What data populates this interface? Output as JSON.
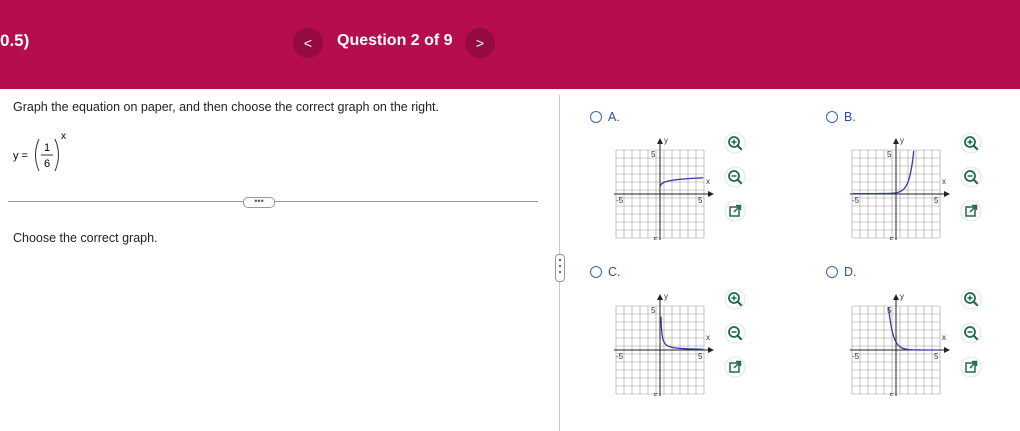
{
  "header": {
    "left_text": "0.5)",
    "question_label": "Question 2 of 9",
    "prev_glyph": "<",
    "next_glyph": ">"
  },
  "prompt": "Graph the equation on paper, and then choose the correct graph on the right.",
  "equation": {
    "lhs": "y =",
    "numerator": "1",
    "denominator": "6",
    "exponent": "x"
  },
  "more_button": "•••",
  "choose_text": "Choose the correct graph.",
  "options": [
    {
      "letter": "A.",
      "curve": "log-up-from-asymptote"
    },
    {
      "letter": "B.",
      "curve": "exp-growth"
    },
    {
      "letter": "C.",
      "curve": "recip-decay"
    },
    {
      "letter": "D.",
      "curve": "steep-decay"
    }
  ],
  "axis": {
    "x_label": "x",
    "y_label": "y",
    "pos_tick": "5",
    "neg_tick": "-5"
  },
  "tools": [
    "zoom-in-icon",
    "zoom-out-icon",
    "open-window-icon"
  ],
  "colors": {
    "header": "#b50d4e",
    "nav_button": "#950a41",
    "curve": "#3a3a9a",
    "option_label": "#2a4ea0"
  }
}
